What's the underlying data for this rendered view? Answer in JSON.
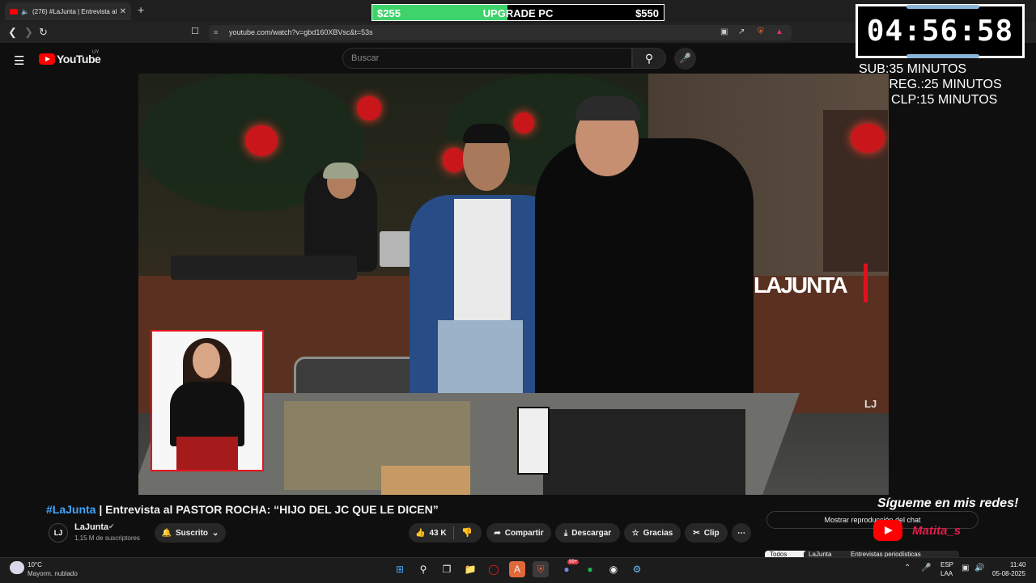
{
  "browser": {
    "tab_title": "(276) #LaJunta | Entrevista al",
    "url": "youtube.com/watch?v=gbd160XBVsc&t=53s"
  },
  "upgrade_overlay": {
    "current": "$255",
    "label": "UPGRADE PC",
    "goal": "$550",
    "progress": 0.464,
    "fill_color": "#3ed36b"
  },
  "timer_overlay": {
    "time": "04:56:58",
    "rules": [
      "SUB:35 MINUTOS",
      "SUB REG.:25 MINUTOS",
      "1000 CLP:15 MINUTOS"
    ]
  },
  "youtube": {
    "logo_text": "YouTube",
    "country": "UY",
    "search_placeholder": "Buscar",
    "video_watermark": "LAJUNTA",
    "title_hashtag": "#LaJunta",
    "title_rest": " | Entrevista al PASTOR ROCHA: “HIJO DEL JC QUE LE DICEN”",
    "channel_avatar": "LJ",
    "channel_name": "LaJunta",
    "channel_subs": "1,15 M de suscriptores",
    "actions": {
      "subscribed": "Suscrito",
      "likes": "43 K",
      "share": "Compartir",
      "download": "Descargar",
      "thanks": "Gracias",
      "clip": "Clip",
      "more": "⋯"
    },
    "chat_replay": "Mostrar reproducción del chat",
    "chips": [
      "Todos",
      "LaJunta",
      "Entrevistas periodísticas"
    ]
  },
  "stream_overlay": {
    "follow_text": "Sígueme en mis redes!",
    "handle": "Matita_s"
  },
  "taskbar": {
    "temp": "10°C",
    "weather": "Mayorm. nublado",
    "lang_1": "ESP",
    "lang_2": "LAA",
    "time": "11:40",
    "date": "05-08-2025",
    "discord_badge": "99+"
  },
  "colors": {
    "yt_red": "#ff0000",
    "link_blue": "#3ea6ff",
    "lajunta_red": "#e0111d"
  }
}
